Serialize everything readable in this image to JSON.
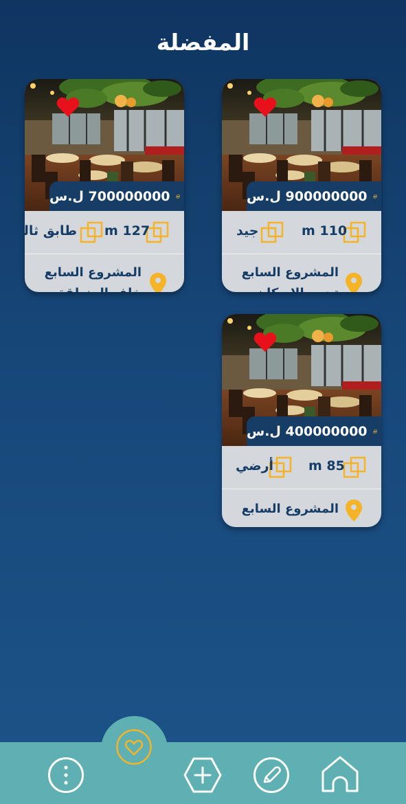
{
  "page": {
    "title": "المفضلة"
  },
  "cards": [
    {
      "price": "900000000 ل.س",
      "area": "m 110",
      "attribute": "جيد",
      "location_line1": "المشروع السابع",
      "location_line2": "تجمع الإسكان"
    },
    {
      "price": "700000000 ل.س",
      "area": "m 127",
      "attribute": "طابق ثالث",
      "location_line1": "المشروع السابع",
      "location_line2": "خلف المنطقة"
    },
    {
      "price": "400000000 ل.س",
      "area": "m 85",
      "attribute": "أرضي",
      "location_line1": "المشروع السابع",
      "location_line2": ""
    }
  ],
  "nav": {
    "items": [
      "more-icon",
      "favorites-heart-icon",
      "add-hexagon-icon",
      "edit-pencil-icon",
      "home-icon"
    ],
    "active": "favorites-heart-icon"
  },
  "colors": {
    "background_top": "#0f3561",
    "background_bottom": "#1c5489",
    "card": "#d4d7dc",
    "price_strip": "#163d66",
    "accent_yellow": "#f5b428",
    "heart_red": "#e8101a",
    "navbar": "#5fb0b2"
  }
}
